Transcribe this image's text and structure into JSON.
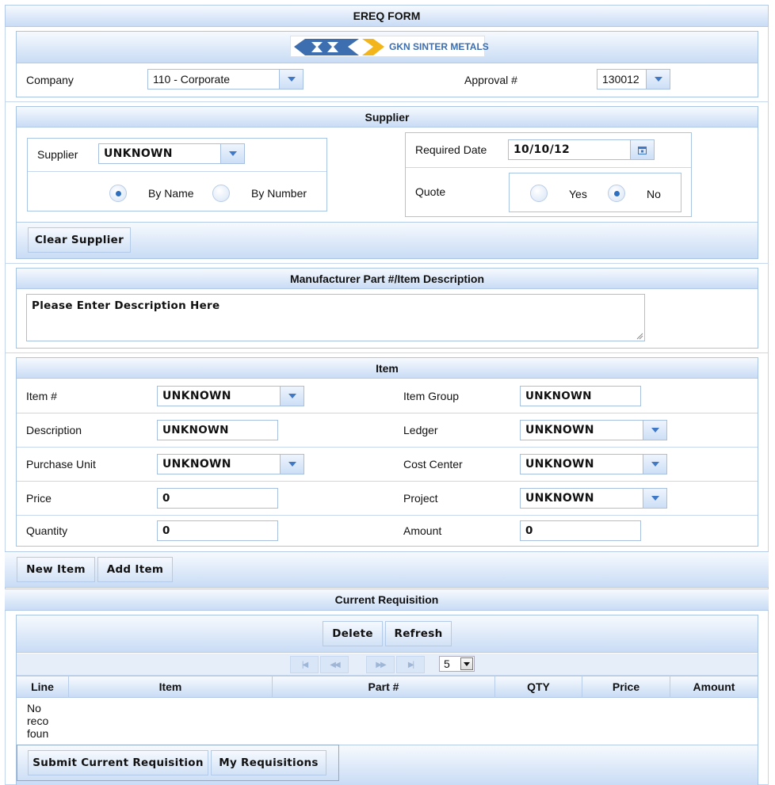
{
  "form_title": "EREQ FORM",
  "logo": {
    "text": "GKN SINTER METALS",
    "colors": {
      "blue": "#3c6eb0",
      "yellow": "#f2b51c"
    }
  },
  "header": {
    "company_label": "Company",
    "company_value": "110 - Corporate",
    "approval_label": "Approval #",
    "approval_value": "130012"
  },
  "supplier": {
    "title": "Supplier",
    "supplier_label": "Supplier",
    "supplier_value": "UNKNOWN",
    "by_name_label": "By Name",
    "by_number_label": "By Number",
    "search_mode_selected": "By Name",
    "required_date_label": "Required Date",
    "required_date_value": "10/10/12",
    "quote_label": "Quote",
    "quote_yes_label": "Yes",
    "quote_no_label": "No",
    "quote_selected": "No",
    "clear_button": "Clear Supplier"
  },
  "description": {
    "title": "Manufacturer Part #/Item Description",
    "placeholder": "Please Enter Description Here"
  },
  "item": {
    "title": "Item",
    "item_no_label": "Item #",
    "item_no_value": "UNKNOWN",
    "item_group_label": "Item Group",
    "item_group_value": "UNKNOWN",
    "description_label": "Description",
    "description_value": "UNKNOWN",
    "ledger_label": "Ledger",
    "ledger_value": "UNKNOWN",
    "purchase_unit_label": "Purchase Unit",
    "purchase_unit_value": "UNKNOWN",
    "cost_center_label": "Cost Center",
    "cost_center_value": "UNKNOWN",
    "price_label": "Price",
    "price_value": "0",
    "project_label": "Project",
    "project_value": "UNKNOWN",
    "quantity_label": "Quantity",
    "quantity_value": "0",
    "amount_label": "Amount",
    "amount_value": "0",
    "new_item_button": "New Item",
    "add_item_button": "Add Item"
  },
  "requisition": {
    "title": "Current Requisition",
    "delete_button": "Delete",
    "refresh_button": "Refresh",
    "page_size": "5",
    "columns": [
      "Line",
      "Item",
      "Part #",
      "QTY",
      "Price",
      "Amount"
    ],
    "empty_lines": [
      "No",
      "reco",
      "foun"
    ],
    "submit_button": "Submit Current Requisition",
    "my_requisitions_button": "My Requisitions"
  }
}
